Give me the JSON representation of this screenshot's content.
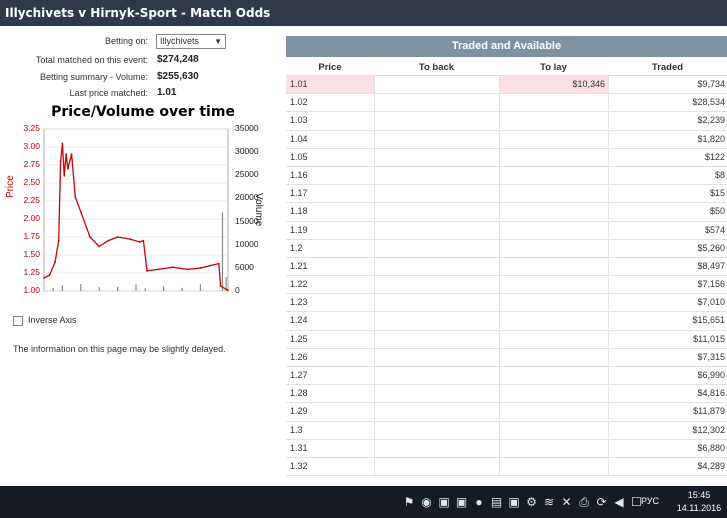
{
  "window": {
    "title": "Illychivets v Hirnyk-Sport - Match Odds"
  },
  "info": {
    "betting_on_label": "Betting on:",
    "betting_on_value": "Illychivets",
    "total_matched_label": "Total matched on this event:",
    "total_matched_value": "$274,248",
    "betting_summary_label": "Betting summary - Volume:",
    "betting_summary_value": "$255,630",
    "last_price_label": "Last price matched:",
    "last_price_value": "1.01"
  },
  "chart_data": {
    "type": "line",
    "title": "Price/Volume over time",
    "ylabel": "Price",
    "y2label": "Volume",
    "ylim": [
      1.0,
      3.25
    ],
    "y2lim": [
      0,
      35000
    ],
    "yticks": [
      "3.25",
      "3.00",
      "2.75",
      "2.50",
      "2.25",
      "2.00",
      "1.75",
      "1.50",
      "1.25",
      "1.00"
    ],
    "y2ticks": [
      "35000",
      "30000",
      "25000",
      "20000",
      "15000",
      "10000",
      "5000",
      "0"
    ],
    "grid": true,
    "series": [
      {
        "name": "Price",
        "color": "#cc0000",
        "points": [
          [
            0,
            1.18
          ],
          [
            0.03,
            1.22
          ],
          [
            0.06,
            1.4
          ],
          [
            0.08,
            1.7
          ],
          [
            0.09,
            2.8
          ],
          [
            0.1,
            3.05
          ],
          [
            0.11,
            2.6
          ],
          [
            0.12,
            2.9
          ],
          [
            0.13,
            2.7
          ],
          [
            0.15,
            2.9
          ],
          [
            0.17,
            2.3
          ],
          [
            0.2,
            2.1
          ],
          [
            0.25,
            1.75
          ],
          [
            0.3,
            1.62
          ],
          [
            0.35,
            1.7
          ],
          [
            0.4,
            1.75
          ],
          [
            0.47,
            1.72
          ],
          [
            0.52,
            1.68
          ],
          [
            0.54,
            1.7
          ],
          [
            0.56,
            1.28
          ],
          [
            0.62,
            1.3
          ],
          [
            0.7,
            1.33
          ],
          [
            0.78,
            1.3
          ],
          [
            0.85,
            1.32
          ],
          [
            0.9,
            1.35
          ],
          [
            0.95,
            1.38
          ],
          [
            0.96,
            1.07
          ],
          [
            1.0,
            1.01
          ]
        ]
      },
      {
        "name": "Volume",
        "color": "#888888",
        "points": [
          [
            0.05,
            700
          ],
          [
            0.1,
            1200
          ],
          [
            0.2,
            1500
          ],
          [
            0.3,
            800
          ],
          [
            0.4,
            900
          ],
          [
            0.5,
            1400
          ],
          [
            0.55,
            600
          ],
          [
            0.65,
            1000
          ],
          [
            0.75,
            700
          ],
          [
            0.85,
            1500
          ],
          [
            0.97,
            17000
          ],
          [
            0.99,
            3000
          ]
        ]
      }
    ]
  },
  "options": {
    "inverse_axis_label": "Inverse Axis",
    "inverse_axis_checked": false
  },
  "notice": "The information on this page may be slightly delayed.",
  "table": {
    "header": "Traded and Available",
    "columns": [
      "Price",
      "To back",
      "To lay",
      "Traded"
    ],
    "rows": [
      {
        "price": "1.01",
        "to_back": "",
        "to_lay": "$10,346",
        "traded": "$9,734"
      },
      {
        "price": "1.02",
        "to_back": "",
        "to_lay": "",
        "traded": "$28,534"
      },
      {
        "price": "1.03",
        "to_back": "",
        "to_lay": "",
        "traded": "$2,239"
      },
      {
        "price": "1.04",
        "to_back": "",
        "to_lay": "",
        "traded": "$1,820"
      },
      {
        "price": "1.05",
        "to_back": "",
        "to_lay": "",
        "traded": "$122"
      },
      {
        "price": "1.16",
        "to_back": "",
        "to_lay": "",
        "traded": "$8"
      },
      {
        "price": "1.17",
        "to_back": "",
        "to_lay": "",
        "traded": "$15"
      },
      {
        "price": "1.18",
        "to_back": "",
        "to_lay": "",
        "traded": "$50"
      },
      {
        "price": "1.19",
        "to_back": "",
        "to_lay": "",
        "traded": "$574"
      },
      {
        "price": "1.2",
        "to_back": "",
        "to_lay": "",
        "traded": "$5,260"
      },
      {
        "price": "1.21",
        "to_back": "",
        "to_lay": "",
        "traded": "$8,497"
      },
      {
        "price": "1.22",
        "to_back": "",
        "to_lay": "",
        "traded": "$7,156"
      },
      {
        "price": "1.23",
        "to_back": "",
        "to_lay": "",
        "traded": "$7,010"
      },
      {
        "price": "1.24",
        "to_back": "",
        "to_lay": "",
        "traded": "$15,651"
      },
      {
        "price": "1.25",
        "to_back": "",
        "to_lay": "",
        "traded": "$11,015"
      },
      {
        "price": "1.26",
        "to_back": "",
        "to_lay": "",
        "traded": "$7,315"
      },
      {
        "price": "1.27",
        "to_back": "",
        "to_lay": "",
        "traded": "$6,990"
      },
      {
        "price": "1.28",
        "to_back": "",
        "to_lay": "",
        "traded": "$4,816"
      },
      {
        "price": "1.29",
        "to_back": "",
        "to_lay": "",
        "traded": "$11,879"
      },
      {
        "price": "1.3",
        "to_back": "",
        "to_lay": "",
        "traded": "$12,302"
      },
      {
        "price": "1.31",
        "to_back": "",
        "to_lay": "",
        "traded": "$6,880"
      },
      {
        "price": "1.32",
        "to_back": "",
        "to_lay": "",
        "traded": "$4,289"
      }
    ]
  },
  "taskbar": {
    "language": "РУС",
    "time": "15:45",
    "date": "14.11.2016",
    "icons": [
      "flag-icon",
      "chrome-icon",
      "app-icon",
      "app-icon",
      "record-icon",
      "folder-icon",
      "app-icon",
      "settings-icon",
      "wifi-icon",
      "mute-icon",
      "printer-icon",
      "sync-icon",
      "volume-icon",
      "notification-icon"
    ]
  }
}
